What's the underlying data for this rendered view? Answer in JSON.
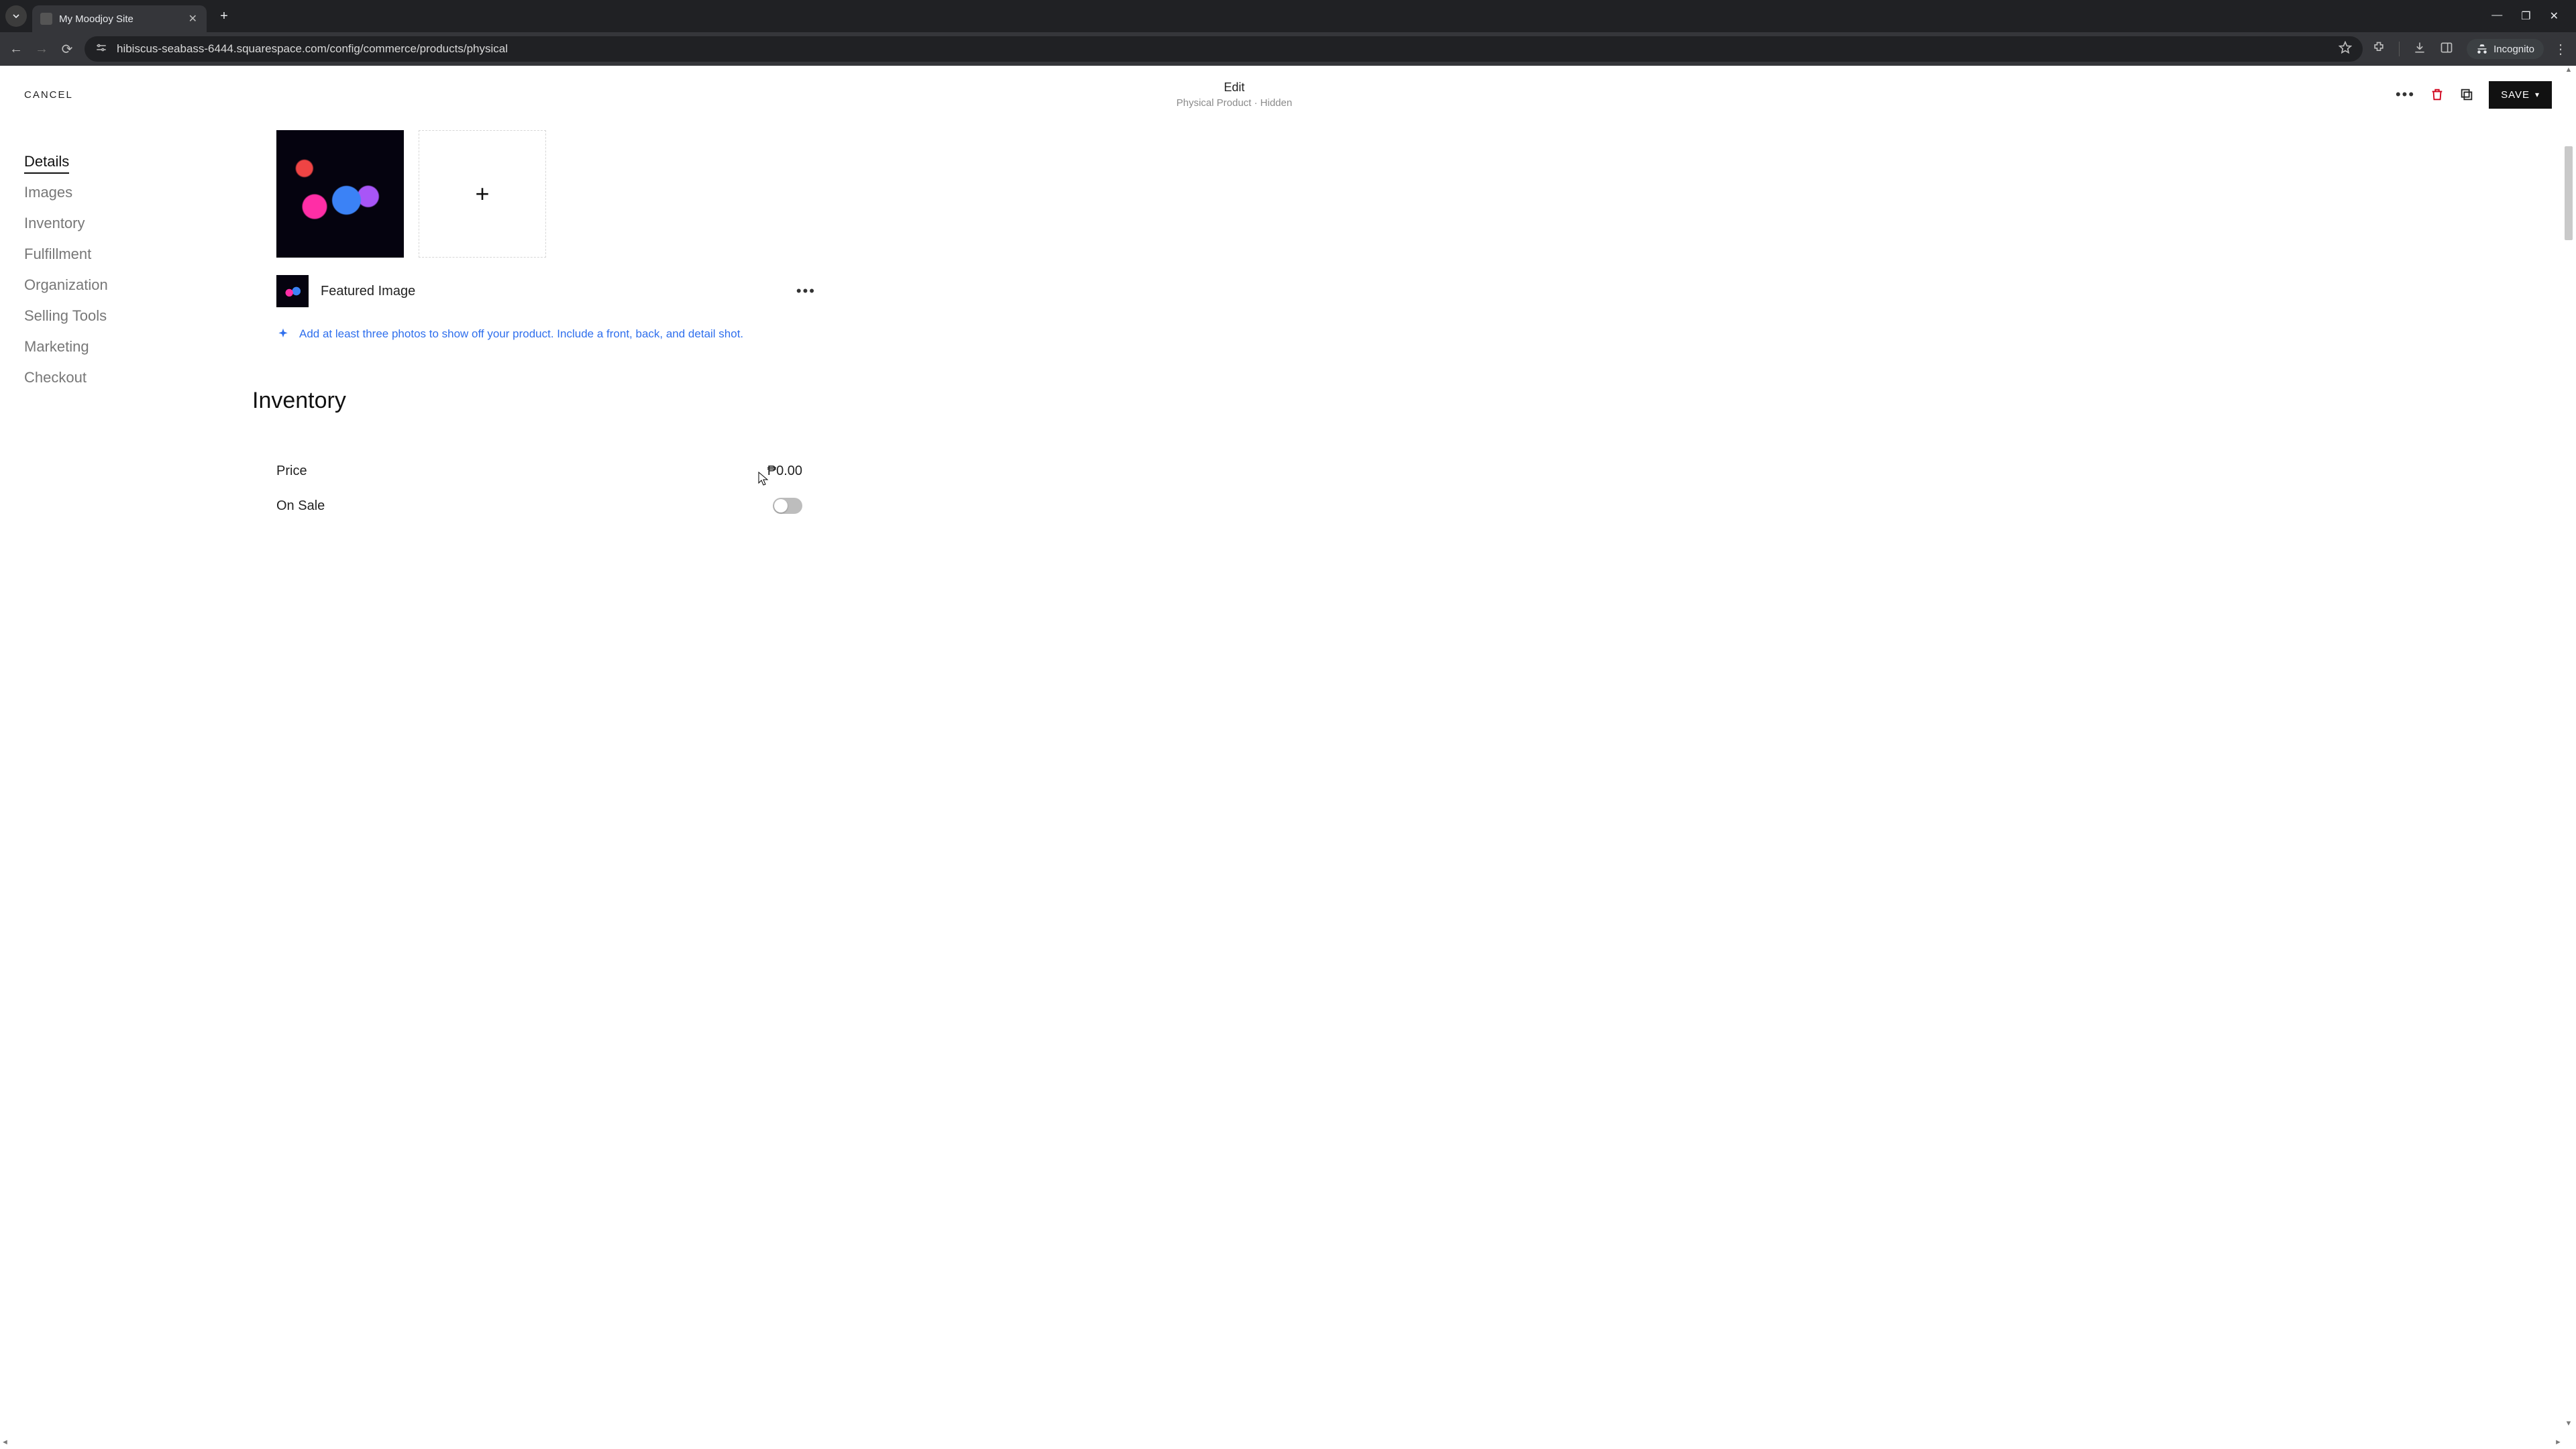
{
  "browser": {
    "tab_title": "My Moodjoy Site",
    "url": "hibiscus-seabass-6444.squarespace.com/config/commerce/products/physical",
    "incognito_label": "Incognito"
  },
  "header": {
    "cancel_label": "CANCEL",
    "title": "Edit",
    "subtitle": "Physical Product · Hidden",
    "save_label": "SAVE"
  },
  "sidebar": {
    "items": [
      {
        "label": "Details",
        "active": true
      },
      {
        "label": "Images",
        "active": false
      },
      {
        "label": "Inventory",
        "active": false
      },
      {
        "label": "Fulfillment",
        "active": false
      },
      {
        "label": "Organization",
        "active": false
      },
      {
        "label": "Selling Tools",
        "active": false
      },
      {
        "label": "Marketing",
        "active": false
      },
      {
        "label": "Checkout",
        "active": false
      }
    ]
  },
  "images": {
    "featured_label": "Featured Image",
    "tip_text": "Add at least three photos to show off your product. Include a front, back, and detail shot."
  },
  "inventory": {
    "section_title": "Inventory",
    "price_label": "Price",
    "price_value": "₱0.00",
    "on_sale_label": "On Sale",
    "on_sale": false
  }
}
